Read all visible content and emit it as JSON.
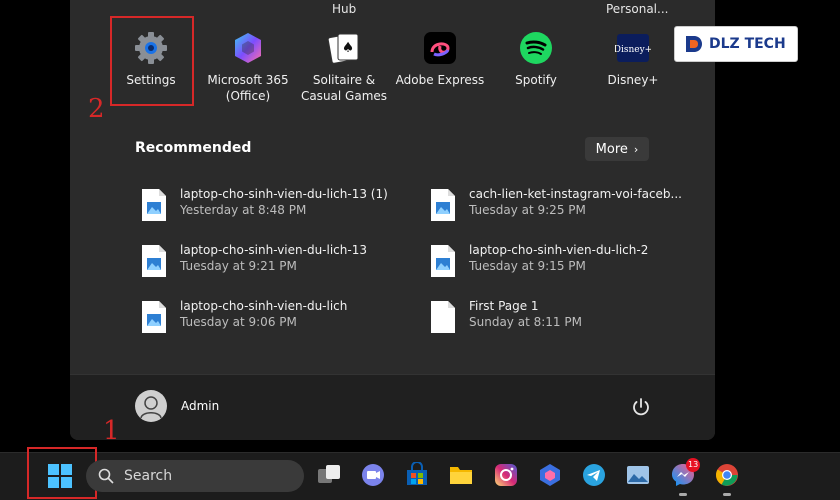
{
  "top_row_labels": [
    "Hub",
    "Personal..."
  ],
  "pinned_apps": [
    {
      "label": "Settings",
      "icon": "gear-icon"
    },
    {
      "label": "Microsoft 365\n(Office)",
      "icon": "microsoft-365-icon"
    },
    {
      "label": "Solitaire &\nCasual Games",
      "icon": "solitaire-icon"
    },
    {
      "label": "Adobe Express",
      "icon": "adobe-express-icon"
    },
    {
      "label": "Spotify",
      "icon": "spotify-icon"
    },
    {
      "label": "Disney+",
      "icon": "disney-plus-icon"
    }
  ],
  "annotations": {
    "step1": "1",
    "step2": "2"
  },
  "recommended": {
    "title": "Recommended",
    "more_label": "More",
    "items": [
      {
        "name": "laptop-cho-sinh-vien-du-lich-13 (1)",
        "time": "Yesterday at 8:48 PM",
        "icon": "image-file-icon"
      },
      {
        "name": "cach-lien-ket-instagram-voi-faceb...",
        "time": "Tuesday at 9:25 PM",
        "icon": "image-file-icon"
      },
      {
        "name": "laptop-cho-sinh-vien-du-lich-13",
        "time": "Tuesday at 9:21 PM",
        "icon": "image-file-icon"
      },
      {
        "name": "laptop-cho-sinh-vien-du-lich-2",
        "time": "Tuesday at 9:15 PM",
        "icon": "image-file-icon"
      },
      {
        "name": "laptop-cho-sinh-vien-du-lich",
        "time": "Tuesday at 9:06 PM",
        "icon": "image-file-icon"
      },
      {
        "name": "First Page 1",
        "time": "Sunday at 8:11 PM",
        "icon": "blank-file-icon"
      }
    ]
  },
  "user": {
    "name": "Admin"
  },
  "logo": {
    "text": "DLZ TECH"
  },
  "taskbar": {
    "search_placeholder": "Search",
    "messenger_badge": "13"
  },
  "colors": {
    "annotation": "#d62828",
    "panel": "#2b2b2b",
    "footer": "#202020"
  }
}
